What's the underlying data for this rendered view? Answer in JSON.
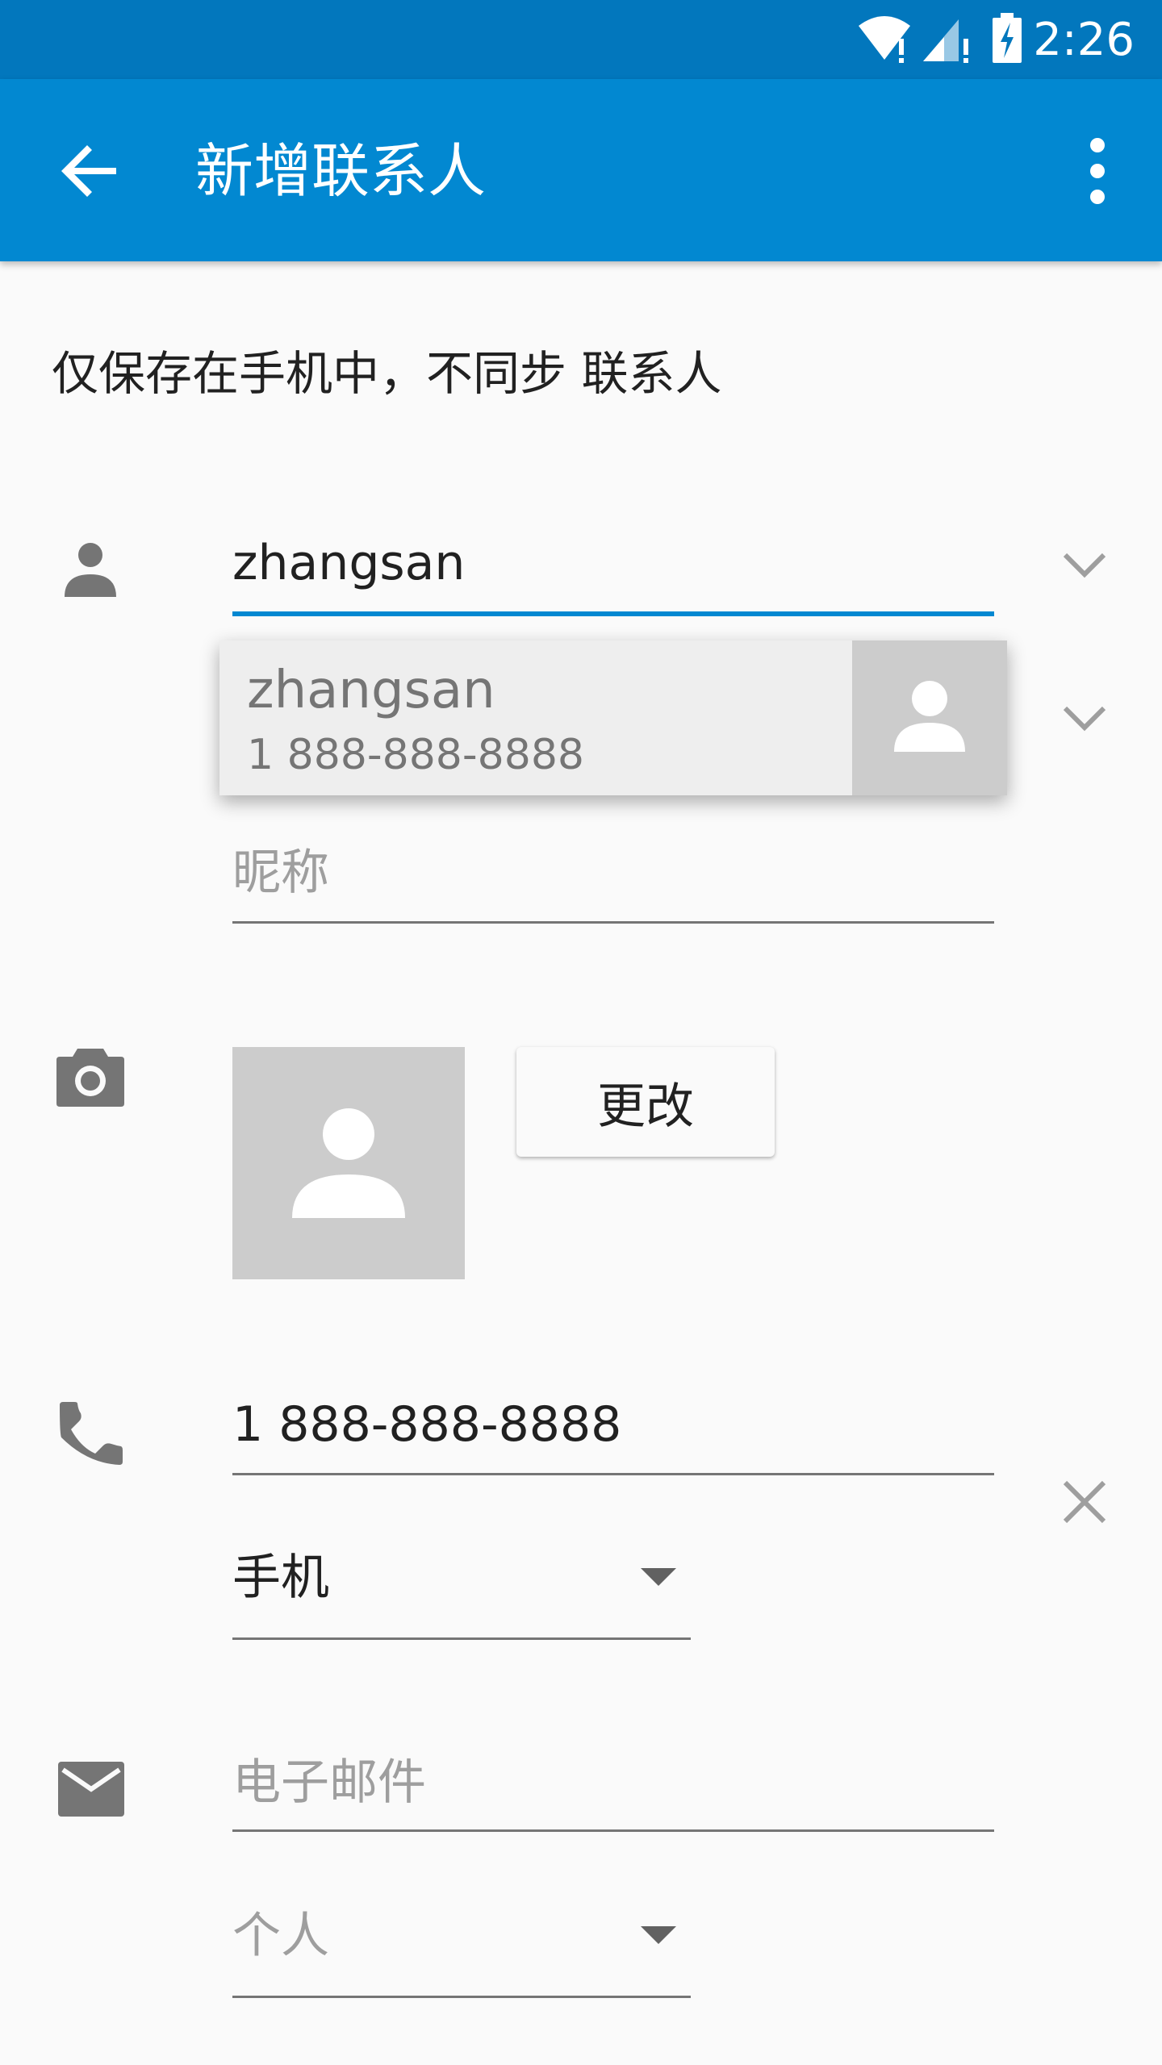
{
  "status_bar": {
    "time": "2:26",
    "icons": [
      "wifi-icon",
      "signal-icon",
      "battery-charging-icon"
    ]
  },
  "app_bar": {
    "title": "新增联系人",
    "back_icon": "arrow-back-icon",
    "menu_icon": "more-vert-icon"
  },
  "account_note": "仅保存在手机中，不同步 联系人",
  "name_section": {
    "icon": "person-icon",
    "name_value": "zhangsan",
    "nickname_placeholder": "昵称"
  },
  "suggestion": {
    "name": "zhangsan",
    "phone": "1 888-888-8888",
    "avatar_icon": "person-icon"
  },
  "photo_section": {
    "icon": "camera-icon",
    "change_label": "更改"
  },
  "phone_section": {
    "icon": "phone-icon",
    "phone_value": "1 888-888-8888",
    "phone_type": "手机",
    "remove_icon": "close-icon"
  },
  "email_section": {
    "icon": "email-icon",
    "email_placeholder": "电子邮件",
    "email_type": "个人"
  },
  "colors": {
    "status_bar": "#0277bd",
    "app_bar": "#0288d1",
    "accent": "#0288d1",
    "background": "#fafafa"
  }
}
